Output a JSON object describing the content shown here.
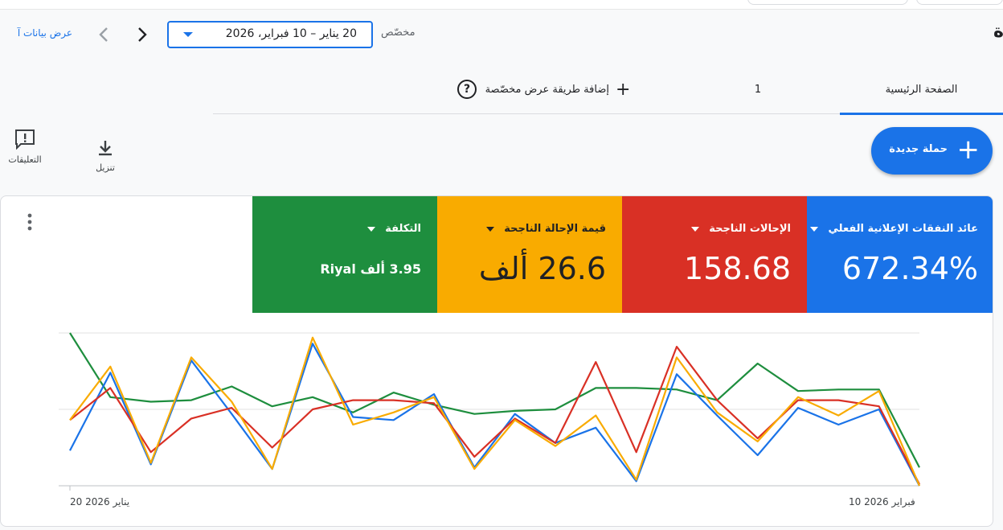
{
  "header": {
    "page_title": "ة",
    "custom_label": "مخصّص",
    "date_range": "20 يناير – 10 فبراير، 2026",
    "view_data_link": "عرض بيانات آ"
  },
  "tabs": {
    "home": "الصفحة الرئيسية",
    "one": "1",
    "add_custom_view": "إضافة طريقة عرض مخصّصة",
    "help_glyph": "?"
  },
  "fab": {
    "label": "حملة جديدة"
  },
  "tools": {
    "feedback": "التعليقات",
    "download": "تنزيل"
  },
  "metrics": [
    {
      "label": "عائد النفقات الإعلانية الفعلي",
      "value": "672.34%",
      "color": "#1a73e8"
    },
    {
      "label": "الإحالات الناجحة",
      "value": "158.68",
      "color": "#d93025"
    },
    {
      "label": "قيمة الإحالة الناجحة",
      "value": "26.6 ألف",
      "color": "#f9ab00"
    },
    {
      "label": "التكلفة",
      "value": "3.95 ألف Riyal",
      "color": "#1e8e3e"
    }
  ],
  "chart_data": {
    "type": "line",
    "x": [
      "20 يناير 2026",
      "21",
      "22",
      "23",
      "24",
      "25",
      "26",
      "27",
      "28",
      "29",
      "30",
      "31",
      "1",
      "2",
      "3",
      "4",
      "5",
      "6",
      "7",
      "8",
      "9",
      "10 فبراير 2026"
    ],
    "x_tick_labels": [
      "20 يناير 2026",
      "10 فبراير 2026"
    ],
    "grid": true,
    "series": [
      {
        "color": "#1a73e8",
        "values": [
          0.23,
          0.74,
          0.14,
          0.82,
          0.47,
          0.11,
          0.93,
          0.45,
          0.43,
          0.6,
          0.12,
          0.47,
          0.28,
          0.38,
          0.03,
          0.73,
          0.46,
          0.2,
          0.51,
          0.4,
          0.5,
          0.0
        ]
      },
      {
        "color": "#d93025",
        "values": [
          0.43,
          0.64,
          0.22,
          0.44,
          0.51,
          0.25,
          0.5,
          0.56,
          0.56,
          0.54,
          0.19,
          0.44,
          0.28,
          0.81,
          0.22,
          0.91,
          0.56,
          0.31,
          0.56,
          0.56,
          0.52,
          0.01
        ]
      },
      {
        "color": "#f9ab00",
        "values": [
          0.43,
          0.78,
          0.15,
          0.84,
          0.55,
          0.11,
          0.97,
          0.4,
          0.48,
          0.58,
          0.11,
          0.43,
          0.26,
          0.46,
          0.04,
          0.84,
          0.48,
          0.29,
          0.58,
          0.46,
          0.62,
          0.0
        ]
      },
      {
        "color": "#1e8e3e",
        "values": [
          1.0,
          0.58,
          0.55,
          0.56,
          0.65,
          0.52,
          0.58,
          0.48,
          0.61,
          0.53,
          0.47,
          0.49,
          0.5,
          0.64,
          0.64,
          0.63,
          0.56,
          0.8,
          0.62,
          0.63,
          0.63,
          0.12
        ]
      }
    ]
  }
}
